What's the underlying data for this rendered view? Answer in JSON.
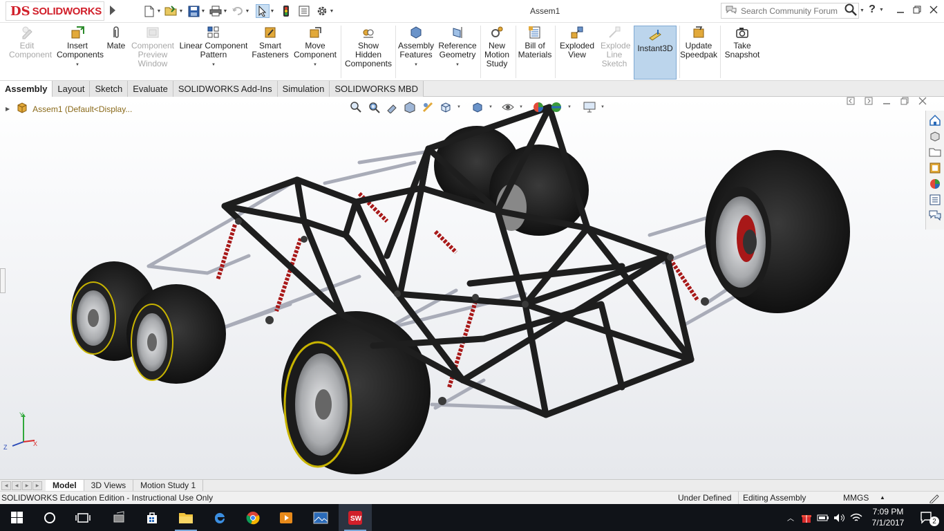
{
  "app": {
    "brand_mark": "DS",
    "brand_name": "SOLIDWORKS",
    "document_title": "Assem1",
    "search_placeholder": "Search Community Forum"
  },
  "quick_access": [
    "new-document",
    "open",
    "save",
    "print",
    "undo",
    "select",
    "rebuild",
    "file-properties",
    "options"
  ],
  "commands": {
    "edit_component": "Edit Component",
    "insert_components": "Insert Components",
    "mate": "Mate",
    "component_preview": "Component Preview Window",
    "linear_pattern": "Linear Component Pattern",
    "smart_fasteners": "Smart Fasteners",
    "move_component": "Move Component",
    "show_hidden": "Show Hidden Components",
    "assembly_features": "Assembly Features",
    "reference_geometry": "Reference Geometry",
    "new_motion_study": "New Motion Study",
    "bill_of_materials": "Bill of Materials",
    "exploded_view": "Exploded View",
    "explode_line_sketch": "Explode Line Sketch",
    "instant3d": "Instant3D",
    "update_speedpak": "Update Speedpak",
    "take_snapshot": "Take Snapshot"
  },
  "tabs": [
    "Assembly",
    "Layout",
    "Sketch",
    "Evaluate",
    "SOLIDWORKS Add-Ins",
    "Simulation",
    "SOLIDWORKS MBD"
  ],
  "feature_tree": {
    "root_label": "Assem1  (Default<Display..."
  },
  "bottom_tabs": [
    "Model",
    "3D Views",
    "Motion Study 1"
  ],
  "status": {
    "edition": "SOLIDWORKS Education Edition - Instructional Use Only",
    "definition": "Under Defined",
    "mode": "Editing Assembly",
    "units": "MMGS"
  },
  "taskbar": {
    "time": "7:09 PM",
    "date": "7/1/2017",
    "notifications": "2"
  },
  "colors": {
    "brand_red": "#d11f2a",
    "frame_tube": "#1e1e1e",
    "spring": "#a81818",
    "tire": "#1a1a1a",
    "rim": "#b7b9bc",
    "taskbar": "#101318"
  }
}
